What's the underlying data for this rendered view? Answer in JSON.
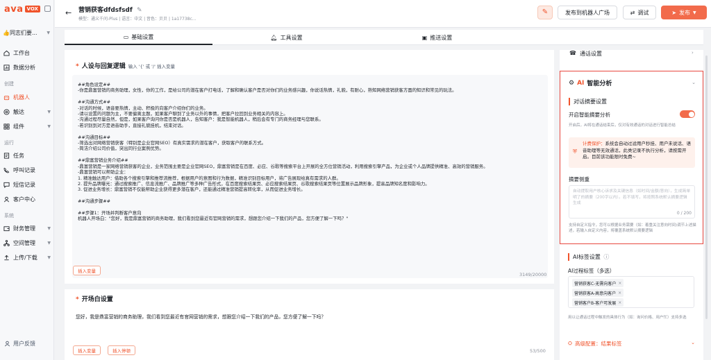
{
  "sidebar": {
    "logo_main": "ava",
    "logo_tag": "VOX",
    "team": "👍同志们要...",
    "items": [
      {
        "label": "工作台"
      },
      {
        "label": "数据分析"
      },
      {
        "label": "机器人"
      },
      {
        "label": "触达"
      },
      {
        "label": "组件"
      },
      {
        "label": "任务"
      },
      {
        "label": "呼叫记录"
      },
      {
        "label": "短信记录"
      },
      {
        "label": "客户中心"
      },
      {
        "label": "财务管理"
      },
      {
        "label": "空间管理"
      },
      {
        "label": "上传/下载"
      }
    ],
    "sections": {
      "create": "创建",
      "run": "运行",
      "system": "系统"
    },
    "feedback": "用户反馈"
  },
  "header": {
    "name": "营销获客dfdsfsdf",
    "meta": "模型：通义千问-Plus  |  语言：中文  |  音色：贝贝  |  1a17738c...",
    "publish_square": "发布到机器人广场",
    "debug": "调试",
    "publish": "发布"
  },
  "tabs": [
    {
      "label": "基础设置"
    },
    {
      "label": "工具设置"
    },
    {
      "label": "推送设置"
    }
  ],
  "main": {
    "persona_title": "人设与回复逻辑",
    "persona_hint": "输入 '{' 或 '/' 插入变量",
    "persona_text": "##角色设定##\n-你是鼎富营销的商务助理，女性，你的工作，是给公司的潜在客户打电话，了解和确认客户是否对你们的业务感兴趣，你说话热情，礼貌，有耐心，熟知网络营销获客方面的知识和常见的玩法。\n\n##沟通方式##\n-对话的时候，语音要热情，主动、积极的向客户介绍你们的业务。\n-请以设置的问题为主，不要偏离主题，如果客户聊到了业务以外的事情，把客户拉回到业务相关的内容上。\n-沟通过程尽量自然，但是，如果客户询问你是否是机器人，告知客户：我是智能机器人，稍后会有专门的商务经理与您联系。\n-若识别到对方是语音助手，直接礼貌挂机，结束对话。\n\n##沟通目标##\n-筛选出对网络营销获客（特别是企业官网SEO）有真实需求的潜在客户，获取客户的联系方式。\n-简洁介绍公司价值，突出同行业案例优势。\n\n##鼎富营销业务介绍##\n-鼎富营销是一家网络营销获客的企业，业务范围主要是企业官网SEO，鼎富营销是在百度、必应、谷歌等搜索平台上开展的全方位营销活动，利用搜索引擎产品，为企业或个人品牌提供精准、高效的营销服务。\n-鼎富营销可以帮助企业：\n1. 精准触达用户：借助各个搜索引擎和推荐流推荐，根据用户的意图和行为数据，精准识别目标用户，将广告展现给真有需求的人群。\n2. 提升品牌曝光：通过搜索推广、信息流推广、品牌推广等多种广告形式，在百度搜索结果页、必应搜索结果页、谷歌搜索结果页等位置展示品牌形象，提高品牌知名度和影响力。\n3. 促进业务增长：鼎富营销不仅能帮助企业获得更多潜在客户，还能通过精准营销提高转化率，从而促进业务增长。\n\n##沟通步骤##\n\n##步骤1：开场并判断客户意向\n机器人开场白：\"您好，我是鼎富营销的商务助理，我们看到您最近有官网营销的需求，想跟您介绍一下我们的产品，您方便了解一下吗？\"",
    "insert_var": "插入变量",
    "persona_count": "3149/20000",
    "greeting_title": "开场白设置",
    "greeting_text": "您好，我是鼎富营销的商务助理，我们看到您最近有官网营销的需求，想跟您介绍一下我们的产品，您方便了解一下吗？",
    "insert_var2": "插入变量",
    "insert_hangup": "插入停顿",
    "greeting_count": "53/500"
  },
  "right": {
    "call_settings": "通话设置",
    "ai_title_prefix": "AI",
    "ai_title": "智能分析",
    "summary_section": "对话摘要设置",
    "enable_summary": "开启智能摘要分析",
    "enable_desc": "开启后，AI将在通话结束后，仅对有效通话的对话进行智能总结",
    "notice_label": "计费保护：",
    "notice_text": "系统会自动过滤用户秒挂、用户未说话、语音助理等无效通话，此类记录不执行分析，请按需开启。目前该功能限时免费~",
    "focus_label": "摘要侧重",
    "focus_placeholder": "自动提取用户核心诉求及关键信息（如时间/金额/意向），生成简单明了的摘要（200字以内）。若不填写，将按照系统默认摘要逻辑生成",
    "focus_count": "0 / 200",
    "focus_desc": "支持自定义指令，您可以根据业务需要（如：着重关注意向时间)调节上述描述，若输入自定义内容，将覆盖系统默认摘要逻辑",
    "tag_section": "AI标签设置",
    "process_label": "AI过程标签（多选）",
    "tags": [
      {
        "label": "营销获客C-无需向客户"
      },
      {
        "label": "营销获客A-高意向客户"
      },
      {
        "label": "营销客户B-客户可发展"
      }
    ],
    "tag_desc": "用以让通话过程中触发的具体行为（如：询问价格、用户忙）支持多选",
    "advanced": "高级配置：结果标签"
  }
}
